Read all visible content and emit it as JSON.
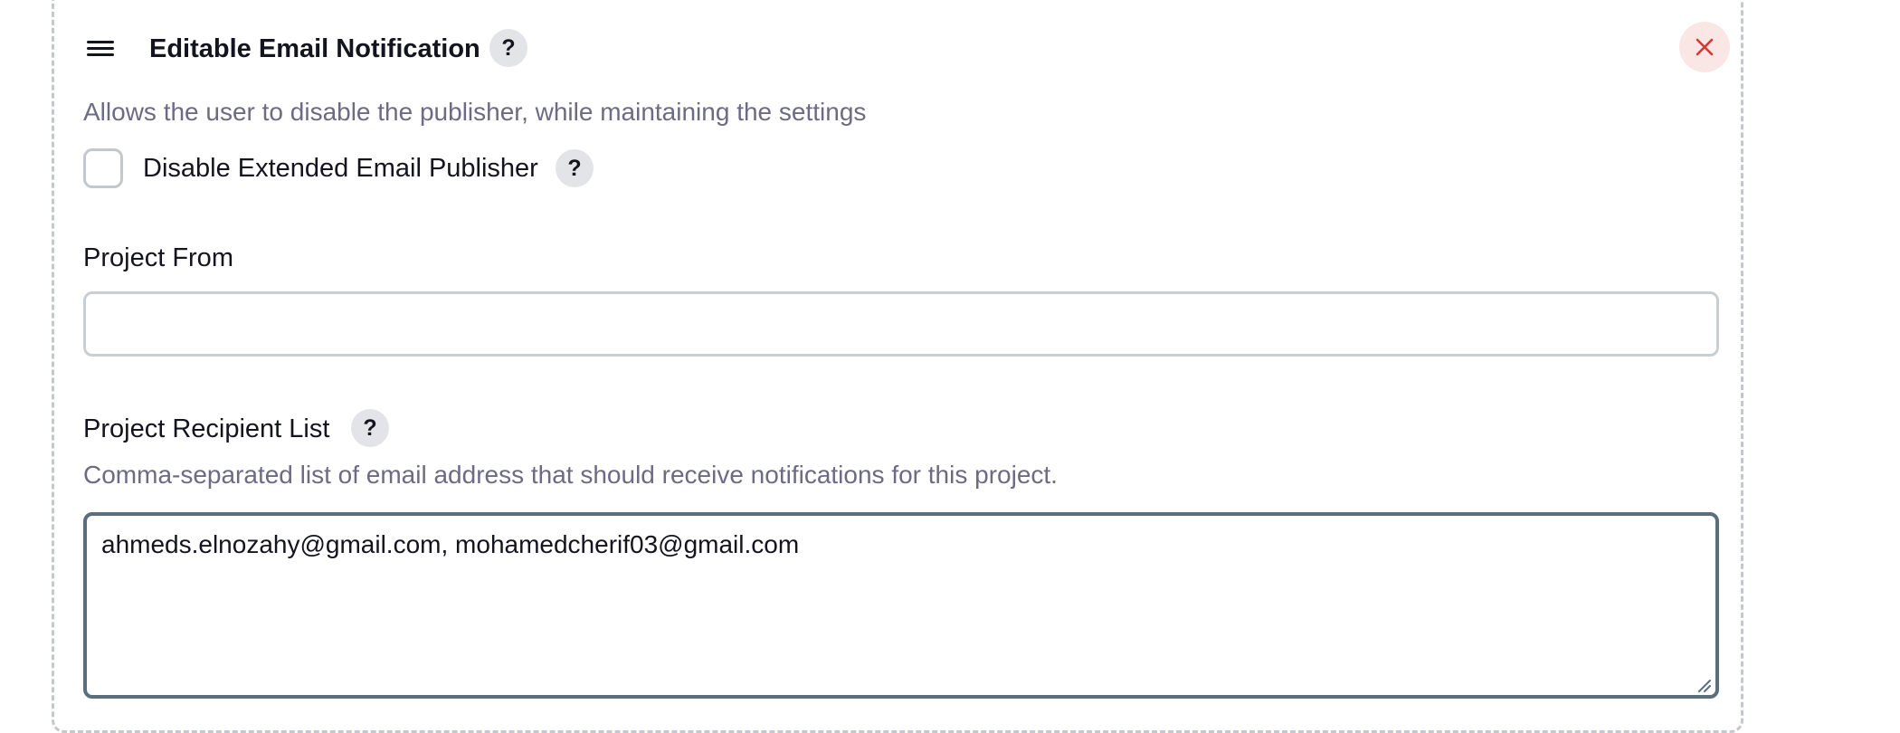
{
  "section": {
    "title": "Editable Email Notification",
    "description": "Allows the user to disable the publisher, while maintaining the settings",
    "help_label": "?",
    "close_label": "×"
  },
  "disable_publisher": {
    "label": "Disable Extended Email Publisher",
    "checked": false,
    "help_label": "?"
  },
  "project_from": {
    "label": "Project From",
    "value": "",
    "placeholder": ""
  },
  "recipient_list": {
    "label": "Project Recipient List",
    "help_label": "?",
    "description": "Comma-separated list of email address that should receive notifications for this project.",
    "value": "ahmeds.elnozahy@gmail.com, mohamedcherif03@gmail.com"
  },
  "icons": {
    "drag": "hamburger-drag-icon",
    "close": "close-x-icon",
    "help": "question-mark-icon",
    "resize": "resize-grip-icon"
  },
  "colors": {
    "close_icon": "#d33833",
    "close_bg": "#fbe6e6",
    "help_bg": "#e3e4e7",
    "description_text": "#6d6b84",
    "focused_border": "#5b6e7b",
    "input_border": "#c9ced3"
  }
}
